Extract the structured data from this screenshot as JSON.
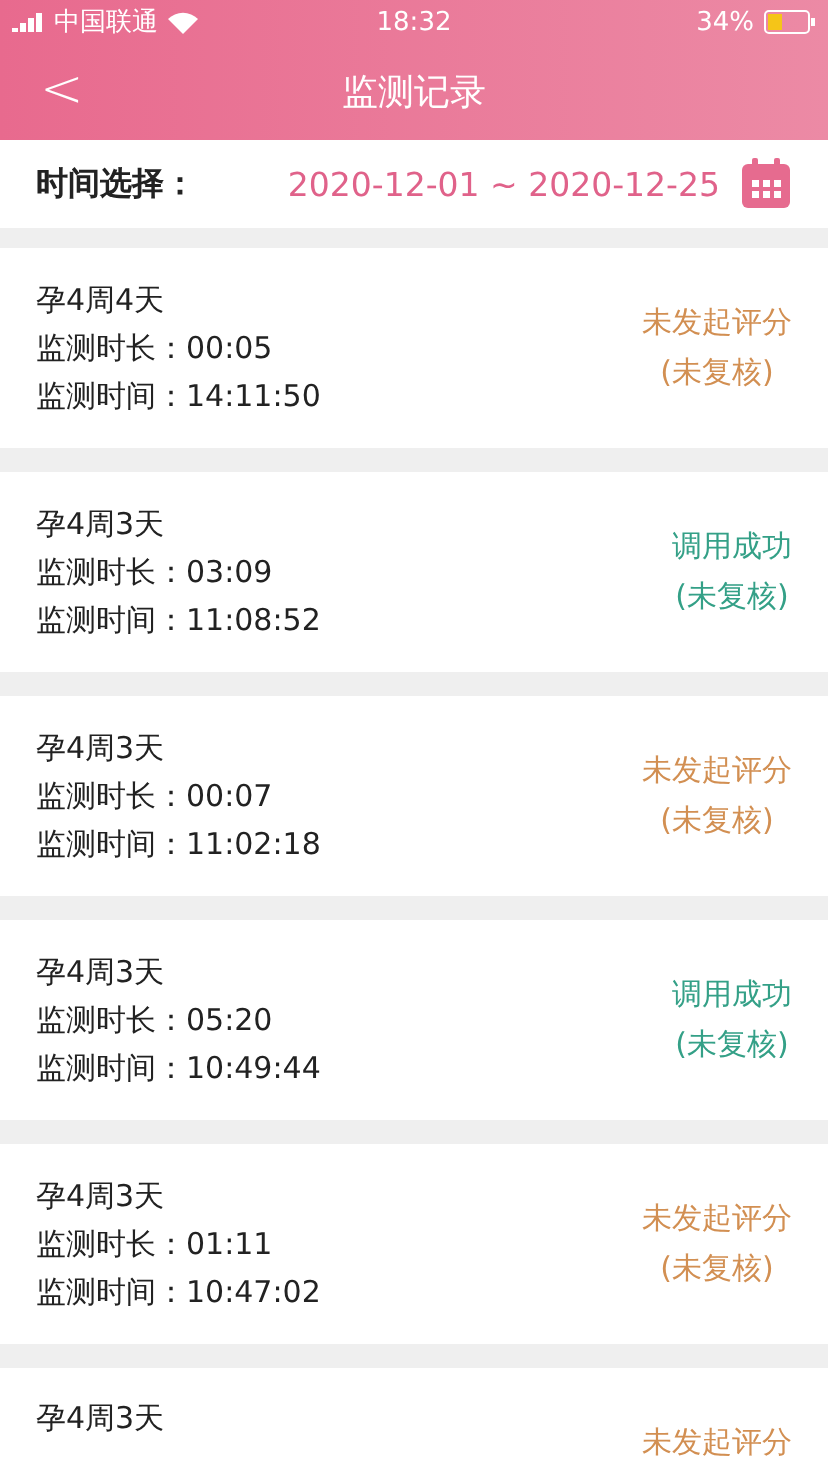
{
  "status_bar": {
    "carrier": "中国联通",
    "time": "18:32",
    "battery": "34%"
  },
  "header": {
    "back": "<",
    "title": "监测记录"
  },
  "filter": {
    "label": "时间选择：",
    "range": "2020-12-01 ~ 2020-12-25"
  },
  "records": [
    {
      "week": "孕4周4天",
      "duration": "监测时长：00:05",
      "time": "监测时间：14:11:50",
      "status": "未发起评分",
      "color": "#d28f52",
      "review": "(未复核)"
    },
    {
      "week": "孕4周3天",
      "duration": "监测时长：03:09",
      "time": "监测时间：11:08:52",
      "status": "调用成功",
      "color": "#34a087",
      "review": "(未复核)"
    },
    {
      "week": "孕4周3天",
      "duration": "监测时长：00:07",
      "time": "监测时间：11:02:18",
      "status": "未发起评分",
      "color": "#d28f52",
      "review": "(未复核)"
    },
    {
      "week": "孕4周3天",
      "duration": "监测时长：05:20",
      "time": "监测时间：10:49:44",
      "status": "调用成功",
      "color": "#34a087",
      "review": "(未复核)"
    },
    {
      "week": "孕4周3天",
      "duration": "监测时长：01:11",
      "time": "监测时间：10:47:02",
      "status": "未发起评分",
      "color": "#d28f52",
      "review": "(未复核)"
    },
    {
      "week": "孕4周3天",
      "status": "未发起评分",
      "color": "#d28f52"
    }
  ]
}
